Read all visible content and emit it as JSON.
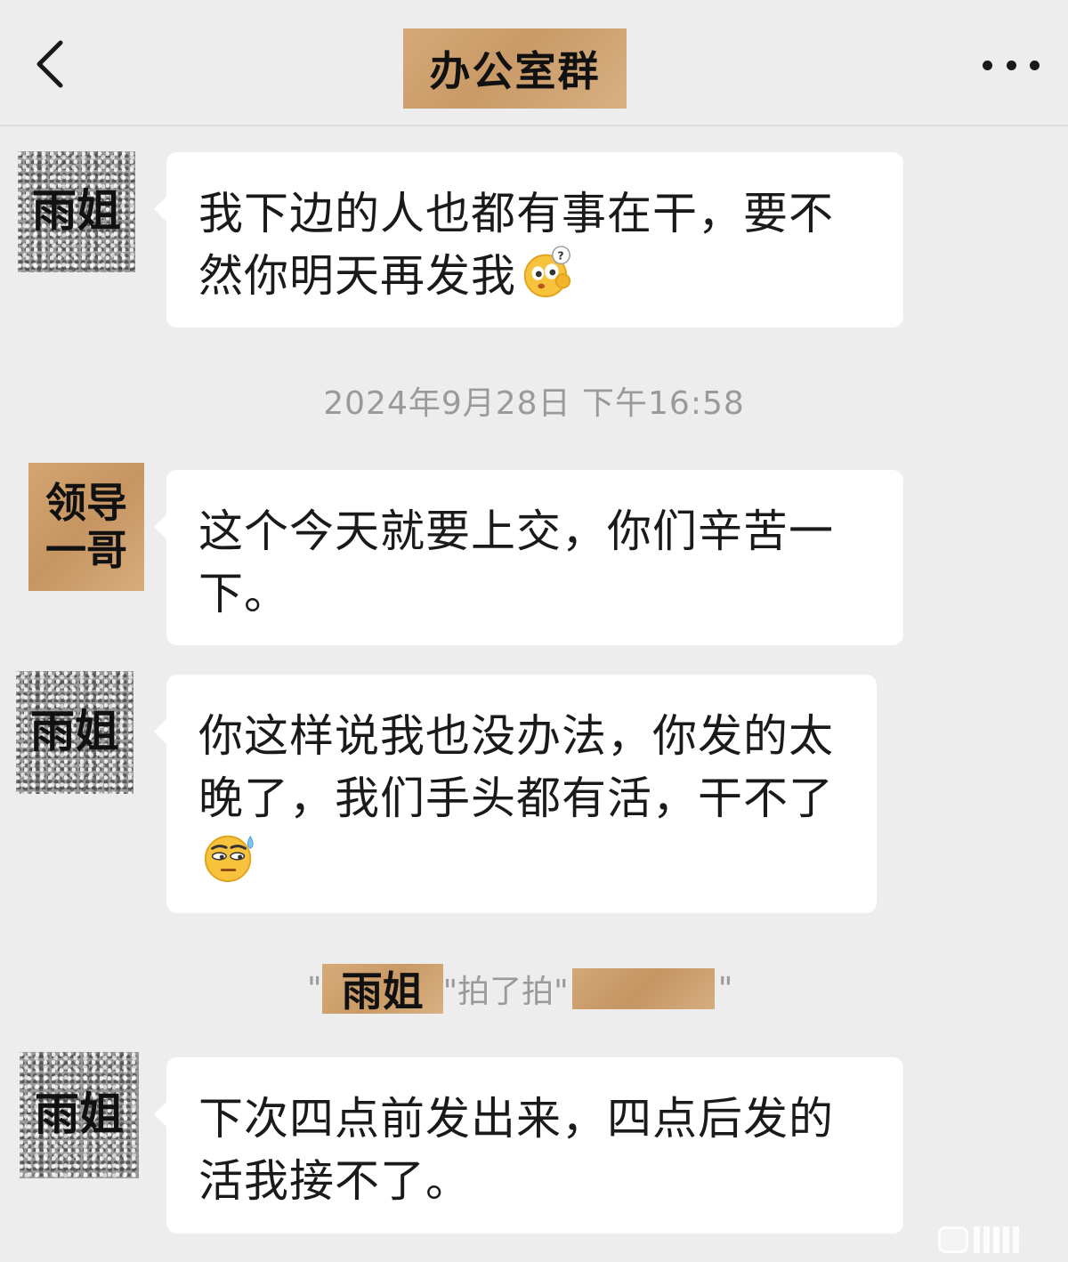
{
  "header": {
    "title": "办公室群"
  },
  "messages": [
    {
      "sender": "雨姐",
      "text": "我下边的人也都有事在干，要不然你明天再发我",
      "emoji": "thinking-question-face"
    },
    {
      "sender": "领导\n一哥",
      "text": "这个今天就要上交，你们辛苦一下。"
    },
    {
      "sender": "雨姐",
      "text": "你这样说我也没办法，你发的太晚了，我们手头都有活，干不了",
      "emoji": "sweat-face"
    },
    {
      "sender": "雨姐",
      "text": "下次四点前发出来，四点后发的活我接不了。"
    }
  ],
  "system": {
    "timestamp": "2024年9月28日 下午16:58",
    "pat": {
      "open_quote": "\"",
      "actor": "雨姐",
      "action": "\"拍了拍\"",
      "close_quote": "\""
    }
  },
  "colors": {
    "background": "#ededed",
    "bubble": "#ffffff",
    "tape": "#c99a67",
    "system_text": "#9a9a9a"
  },
  "icons": [
    "back-chevron-icon",
    "more-dots-icon",
    "thinking-question-emoji-icon",
    "sweat-face-emoji-icon"
  ]
}
